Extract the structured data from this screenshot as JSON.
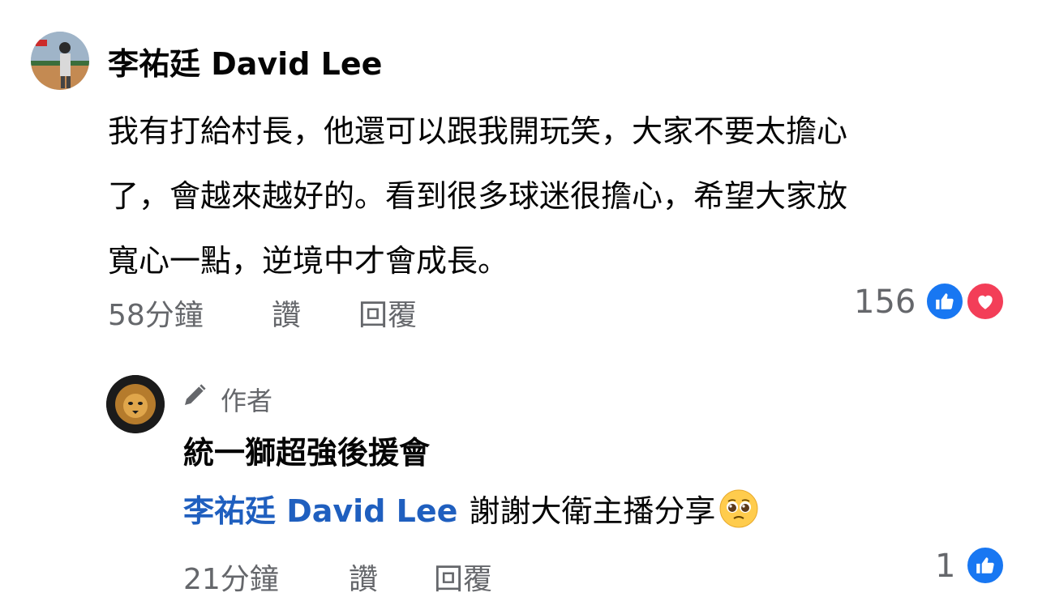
{
  "comment": {
    "author": "李祐廷 David Lee",
    "lines": [
      "我有打給村長，他還可以跟我開玩笑，大家不要太擔心",
      "了，會越來越好的。看到很多球迷很擔心，希望大家放",
      "寬心一點，逆境中才會成長。"
    ],
    "time": "58分鐘",
    "like_label": "讚",
    "reply_label": "回覆",
    "reaction_count": "156",
    "reactions": [
      "like-icon",
      "love-icon"
    ]
  },
  "reply": {
    "badge": "作者",
    "author": "統一獅超強後援會",
    "mention": "李祐廷 David Lee",
    "text": "謝謝大衛主播分享",
    "emoji": "pleading-face-emoji",
    "time": "21分鐘",
    "like_label": "讚",
    "reply_label": "回覆",
    "reaction_count": "1",
    "reactions": [
      "like-icon"
    ]
  },
  "colors": {
    "like_blue": "#1877f2",
    "love_red": "#f33e58",
    "mention_blue": "#1f5fbf",
    "meta_gray": "#65676b"
  }
}
